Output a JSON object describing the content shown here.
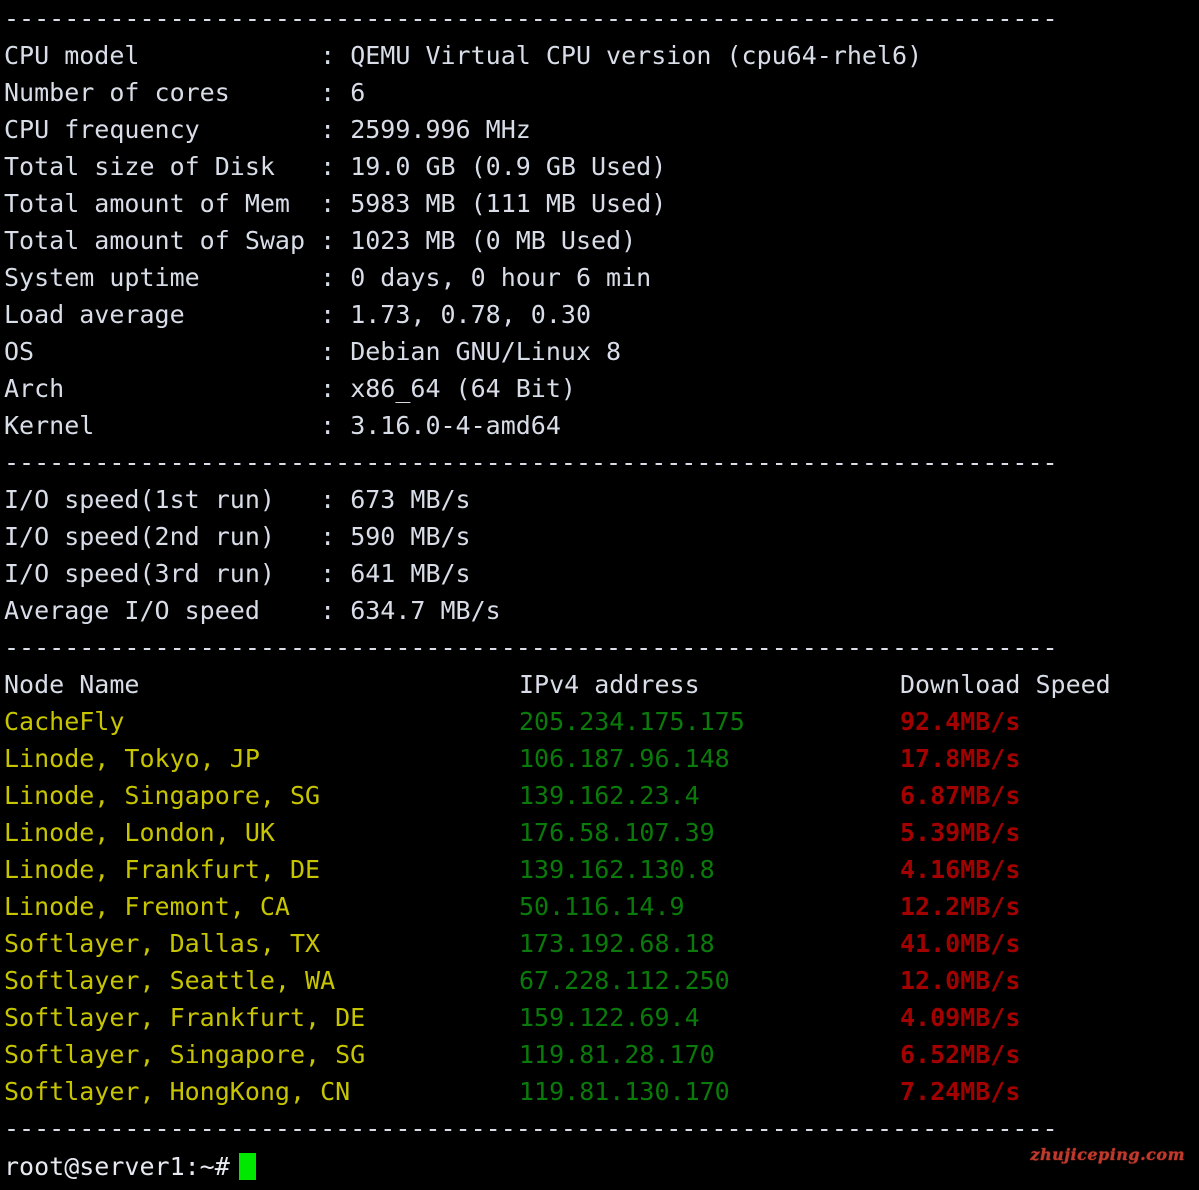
{
  "terminal": {
    "separator": "----------------------------------------------------------------------",
    "colors": {
      "background": "#000000",
      "foreground": "#d8dde8",
      "node_name": "#c7c400",
      "ipv4": "#0a7a0a",
      "download_speed": "#a30000",
      "cursor": "#00e800",
      "watermark": "#c0392b"
    }
  },
  "system_info": {
    "rows": [
      {
        "label": "CPU model",
        "value": "QEMU Virtual CPU version (cpu64-rhel6)"
      },
      {
        "label": "Number of cores",
        "value": "6"
      },
      {
        "label": "CPU frequency",
        "value": "2599.996 MHz"
      },
      {
        "label": "Total size of Disk",
        "value": "19.0 GB (0.9 GB Used)"
      },
      {
        "label": "Total amount of Mem",
        "value": "5983 MB (111 MB Used)"
      },
      {
        "label": "Total amount of Swap",
        "value": "1023 MB (0 MB Used)"
      },
      {
        "label": "System uptime",
        "value": "0 days, 0 hour 6 min"
      },
      {
        "label": "Load average",
        "value": "1.73, 0.78, 0.30"
      },
      {
        "label": "OS",
        "value": "Debian GNU/Linux 8"
      },
      {
        "label": "Arch",
        "value": "x86_64 (64 Bit)"
      },
      {
        "label": "Kernel",
        "value": "3.16.0-4-amd64"
      }
    ]
  },
  "io_speed": {
    "rows": [
      {
        "label": "I/O speed(1st run)",
        "value": "673 MB/s"
      },
      {
        "label": "I/O speed(2nd run)",
        "value": "590 MB/s"
      },
      {
        "label": "I/O speed(3rd run)",
        "value": "641 MB/s"
      },
      {
        "label": "Average I/O speed",
        "value": "634.7 MB/s"
      }
    ]
  },
  "node_table": {
    "headers": {
      "node_name": "Node Name",
      "ipv4": "IPv4 address",
      "download_speed": "Download Speed"
    },
    "rows": [
      {
        "node": "CacheFly",
        "ip": "205.234.175.175",
        "speed": "92.4MB/s"
      },
      {
        "node": "Linode, Tokyo, JP",
        "ip": "106.187.96.148",
        "speed": "17.8MB/s"
      },
      {
        "node": "Linode, Singapore, SG",
        "ip": "139.162.23.4",
        "speed": "6.87MB/s"
      },
      {
        "node": "Linode, London, UK",
        "ip": "176.58.107.39",
        "speed": "5.39MB/s"
      },
      {
        "node": "Linode, Frankfurt, DE",
        "ip": "139.162.130.8",
        "speed": "4.16MB/s"
      },
      {
        "node": "Linode, Fremont, CA",
        "ip": "50.116.14.9",
        "speed": "12.2MB/s"
      },
      {
        "node": "Softlayer, Dallas, TX",
        "ip": "173.192.68.18",
        "speed": "41.0MB/s"
      },
      {
        "node": "Softlayer, Seattle, WA",
        "ip": "67.228.112.250",
        "speed": "12.0MB/s"
      },
      {
        "node": "Softlayer, Frankfurt, DE",
        "ip": "159.122.69.4",
        "speed": "4.09MB/s"
      },
      {
        "node": "Softlayer, Singapore, SG",
        "ip": "119.81.28.170",
        "speed": "6.52MB/s"
      },
      {
        "node": "Softlayer, HongKong, CN",
        "ip": "119.81.130.170",
        "speed": "7.24MB/s"
      }
    ]
  },
  "prompt": {
    "text": "root@server1:~#"
  },
  "watermark": {
    "text": "zhujiceping.com"
  }
}
